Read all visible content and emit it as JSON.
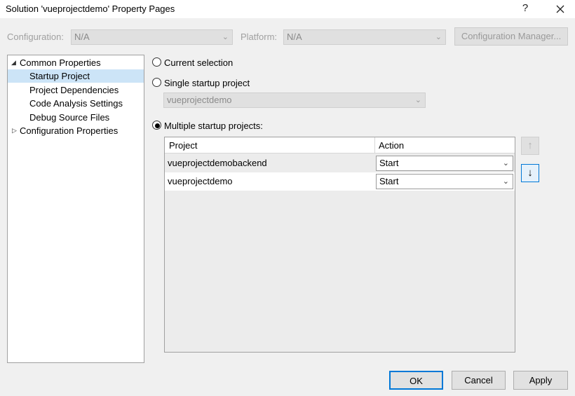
{
  "window": {
    "title": "Solution 'vueprojectdemo' Property Pages",
    "help_glyph": "?",
    "close_glyph": "✕"
  },
  "config_row": {
    "configuration_label": "Configuration:",
    "configuration_value": "N/A",
    "platform_label": "Platform:",
    "platform_value": "N/A",
    "configuration_manager_label": "Configuration Manager..."
  },
  "tree": {
    "items": [
      {
        "label": "Common Properties",
        "expander": "◢"
      },
      {
        "label": "Startup Project"
      },
      {
        "label": "Project Dependencies"
      },
      {
        "label": "Code Analysis Settings"
      },
      {
        "label": "Debug Source Files"
      },
      {
        "label": "Configuration Properties",
        "expander": "▷"
      }
    ],
    "selected_index": 1
  },
  "startup": {
    "current_selection_label": "Current selection",
    "single_startup_label": "Single startup project",
    "single_startup_value": "vueprojectdemo",
    "multiple_startup_label": "Multiple startup projects:",
    "selected_option": "multiple"
  },
  "grid": {
    "headers": {
      "project": "Project",
      "action": "Action"
    },
    "rows": [
      {
        "project": "vueprojectdemobackend",
        "action": "Start"
      },
      {
        "project": "vueprojectdemo",
        "action": "Start"
      }
    ],
    "move_up_glyph": "↑",
    "move_down_glyph": "↓"
  },
  "footer": {
    "ok_label": "OK",
    "cancel_label": "Cancel",
    "apply_label": "Apply"
  },
  "colors": {
    "selection": "#cce4f7",
    "default_button_border": "#0078d7",
    "dialog_background": "#f0f0f0"
  }
}
